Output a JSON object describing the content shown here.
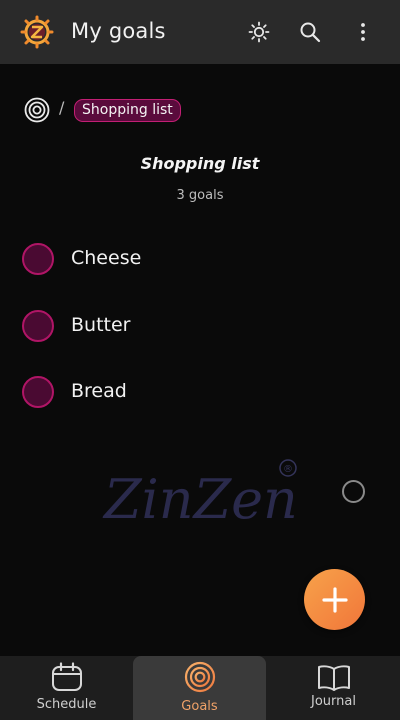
{
  "header": {
    "title": "My goals",
    "icons": [
      "zinzen-logo-icon",
      "sun-icon",
      "search-icon",
      "more-vertical-icon"
    ]
  },
  "breadcrumb": {
    "root_icon": "goals-target-icon",
    "separator": "/",
    "current": "Shopping list"
  },
  "list": {
    "title": "Shopping list",
    "count_label": "3 goals",
    "goals": [
      {
        "label": "Cheese"
      },
      {
        "label": "Butter"
      },
      {
        "label": "Bread"
      }
    ]
  },
  "watermark": {
    "text": "ZinZen",
    "mark": "®"
  },
  "bottom_nav": {
    "items": [
      {
        "label": "Schedule",
        "icon": "calendar-icon"
      },
      {
        "label": "Goals",
        "icon": "goals-target-icon",
        "active": true
      },
      {
        "label": "Journal",
        "icon": "book-icon"
      }
    ]
  },
  "colors": {
    "accent_orange": "#f1763a",
    "goal_magenta": "#b01566",
    "header_bg": "#2a2a2a",
    "background": "#0a0a0a"
  }
}
